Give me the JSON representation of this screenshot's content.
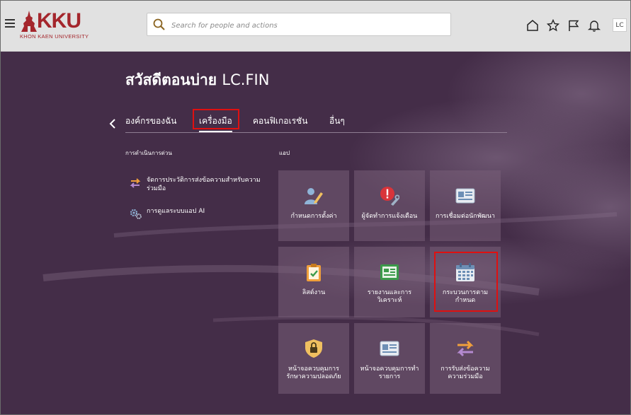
{
  "header": {
    "logo_text": "KKU",
    "logo_sub": "KHON KAEN UNIVERSITY",
    "search_placeholder": "Search for people and actions",
    "avatar": "LC"
  },
  "greeting": {
    "prefix": "สวัสดีตอนบ่าย",
    "name": "LC.FIN"
  },
  "tabs": [
    {
      "label": "องค์กรของฉัน"
    },
    {
      "label": "เครื่องมือ",
      "active": true
    },
    {
      "label": "คอนฟิเกอเรชัน"
    },
    {
      "label": "อื่นๆ"
    }
  ],
  "sections": {
    "quick_actions": "การดำเนินการด่วน",
    "apps": "แอป"
  },
  "quick_actions": [
    {
      "label": "จัดการประวัติการส่งข้อความสำหรับความร่วมมือ"
    },
    {
      "label": "การดูแลระบบแอป AI"
    }
  ],
  "apps": [
    {
      "label": "กำหนดการตั้งค่า",
      "icon": "user-edit-icon"
    },
    {
      "label": "ผู้จัดทำการแจ้งเตือน",
      "icon": "alert-wrench-icon"
    },
    {
      "label": "การเชื่อมต่อนักพัฒนา",
      "icon": "developer-card-icon"
    },
    {
      "label": "ลิสต์งาน",
      "icon": "clipboard-check-icon"
    },
    {
      "label": "รายงานและการวิเคราะห์",
      "icon": "report-icon"
    },
    {
      "label": "กระบวนการตามกำหนด",
      "icon": "calendar-icon"
    },
    {
      "label": "หน้าจอควบคุมการรักษาความปลอดภัย",
      "icon": "security-shield-icon"
    },
    {
      "label": "หน้าจอควบคุมการทำรายการ",
      "icon": "transaction-console-icon"
    },
    {
      "label": "การรับส่งข้อความความร่วมมือ",
      "icon": "swap-arrows-icon"
    }
  ],
  "colors": {
    "accent": "#e01010",
    "brand": "#a4262c",
    "background": "#442d48"
  }
}
